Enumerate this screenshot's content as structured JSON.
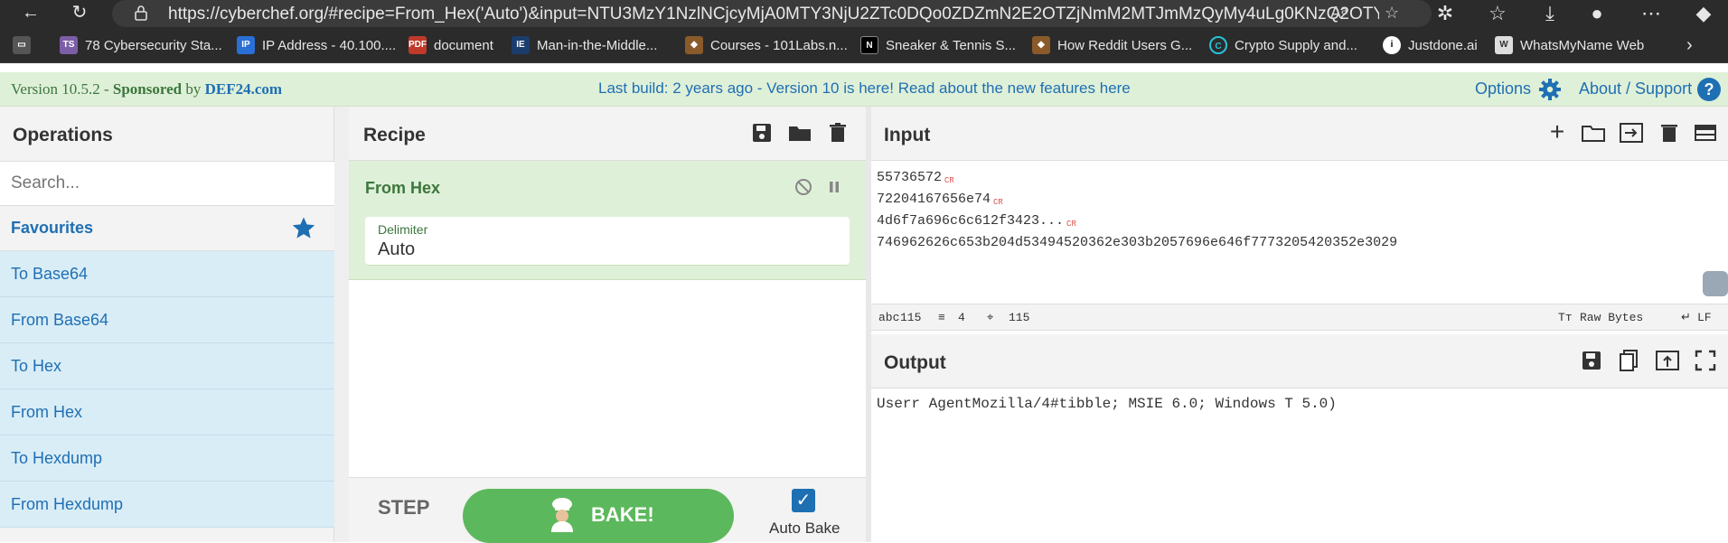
{
  "browser": {
    "url": "https://cyberchef.org/#recipe=From_Hex('Auto')&input=NTU3MzY1NzlNCjcyMjA0MTY3NjU2ZTc0DQo0ZDZmN2E2OTZjNmM2MTJmMzQyMy4uLg0KNzQ2OTYyNj...",
    "bookmarks": [
      {
        "label": "78 Cybersecurity Sta...",
        "icon": "ts-icon"
      },
      {
        "label": "IP Address - 40.100....",
        "icon": "ip-icon"
      },
      {
        "label": "document",
        "icon": "pdf-icon"
      },
      {
        "label": "Man-in-the-Middle...",
        "icon": "ieee-icon"
      },
      {
        "label": "Courses - 101Labs.n...",
        "icon": "labs-icon"
      },
      {
        "label": "Sneaker & Tennis S...",
        "icon": "n-icon"
      },
      {
        "label": "How Reddit Users G...",
        "icon": "reddit-icon"
      },
      {
        "label": "Crypto Supply and...",
        "icon": "crypto-icon"
      },
      {
        "label": "Justdone.ai",
        "icon": "justdone-icon"
      },
      {
        "label": "WhatsMyName Web",
        "icon": "wmn-icon"
      }
    ]
  },
  "banner": {
    "version": "Version 10.5.2 - ",
    "sponsored": "Sponsored",
    "by": " by ",
    "sponsor": "DEF24.com",
    "center": "Last build: 2 years ago - Version 10 is here! Read about the new features here",
    "options": "Options",
    "about": "About / Support"
  },
  "operations": {
    "title": "Operations",
    "search_placeholder": "Search...",
    "favourites": "Favourites",
    "items": [
      "To Base64",
      "From Base64",
      "To Hex",
      "From Hex",
      "To Hexdump",
      "From Hexdump"
    ]
  },
  "recipe": {
    "title": "Recipe",
    "op_name": "From Hex",
    "delimiter_label": "Delimiter",
    "delimiter_value": "Auto",
    "step": "STEP",
    "bake": "BAKE!",
    "auto_bake": "Auto Bake",
    "auto_bake_checked": true
  },
  "input": {
    "title": "Input",
    "lines": [
      {
        "text": "55736572",
        "cr": "CR"
      },
      {
        "text": "72204167656e74",
        "cr": "CR"
      },
      {
        "text": "4d6f7a696c6c612f3423...",
        "cr": "CR"
      },
      {
        "text": "746962626c653b204d53494520362e303b2057696e646f7773205420352e3029",
        "cr": ""
      }
    ],
    "status": {
      "chars": "115",
      "lines": "4",
      "position": "115",
      "encoding": "Raw Bytes",
      "eol": "LF"
    }
  },
  "output": {
    "title": "Output",
    "text": "Userr AgentMozilla/4#tibble; MSIE 6.0; Windows T 5.0)"
  }
}
